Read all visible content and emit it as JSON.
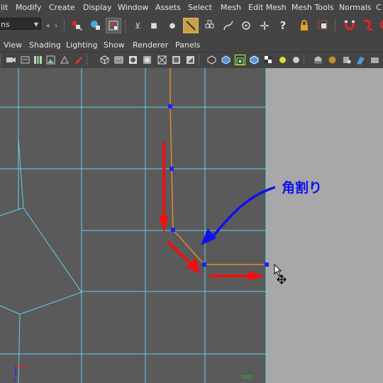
{
  "menubar": {
    "items": [
      "lit",
      "Modify",
      "Create",
      "Display",
      "Window",
      "Assets",
      "Select",
      "Mesh",
      "Edit Mesh",
      "Mesh Tools",
      "Normals",
      "C"
    ]
  },
  "shelf": {
    "mode_select": "ns",
    "icons": [
      "separator-handle",
      "select-hierarchy-icon",
      "select-object-icon",
      "select-component-icon",
      "vertex-mode-icon",
      "edge-mode-icon",
      "face-mode-icon",
      "multi-component-icon",
      "snap-grid-icon",
      "snap-curve-icon",
      "snap-point-icon",
      "snap-plus-icon",
      "help-icon",
      "lock-icon",
      "select-lasso-icon",
      "magnet-icon",
      "soft-select-icon"
    ]
  },
  "panel_menus": [
    "View",
    "Shading",
    "Lighting",
    "Show",
    "Renderer",
    "Panels"
  ],
  "viewport": {
    "annotation": "角割り",
    "view_label": "top",
    "axis_x": "x",
    "axis_z": "z",
    "colors": {
      "grid": "#5fd3f0",
      "edge": "#e08a30",
      "vertex": "#2020ff",
      "arrow_red": "#ee1010",
      "arrow_blue": "#1010ee",
      "background": "#5a5a5a",
      "right_panel": "#a8a8a8"
    }
  }
}
